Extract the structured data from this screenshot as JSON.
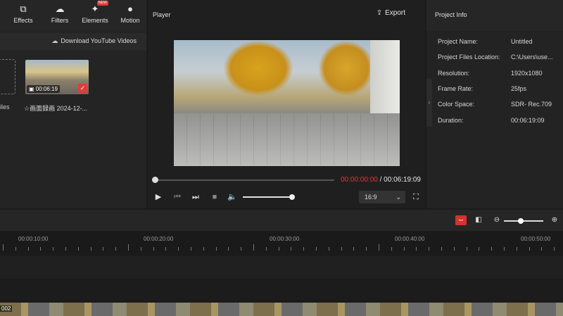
{
  "toolbar": {
    "items": [
      {
        "label": "Effects",
        "icon": "effects-icon"
      },
      {
        "label": "Filters",
        "icon": "filters-icon"
      },
      {
        "label": "Elements",
        "icon": "elements-icon",
        "badge": "NEW"
      },
      {
        "label": "Motion",
        "icon": "motion-icon"
      }
    ]
  },
  "media": {
    "download_label": "Download YouTube Videos",
    "left_label": "iles",
    "thumb_duration": "00:06:19",
    "thumb_name": "☆画面録画 2024-12-..."
  },
  "player": {
    "title": "Player",
    "export_label": "Export",
    "current_time": "00:00:00:00",
    "total_time": "/ 00:06:19:09",
    "aspect_ratio": "16:9",
    "progress": 0,
    "volume": 1.0
  },
  "project_info": {
    "title": "Project Info",
    "rows": [
      {
        "label": "Project Name:",
        "value": "Untitled"
      },
      {
        "label": "Project Files Location:",
        "value": "C:\\Users\\use..."
      },
      {
        "label": "Resolution:",
        "value": "1920x1080"
      },
      {
        "label": "Frame Rate:",
        "value": "25fps"
      },
      {
        "label": "Color Space:",
        "value": "SDR- Rec.709"
      },
      {
        "label": "Duration:",
        "value": "00:06:19:09"
      }
    ]
  },
  "timeline": {
    "ruler_labels": [
      "00:00:10:00",
      "00:00:20:00",
      "00:00:30:00",
      "00:00:40:00",
      "00:00:50:00"
    ],
    "clip_label": "002"
  },
  "colors": {
    "accent": "#e53935",
    "timecode_current": "#ee3333"
  }
}
